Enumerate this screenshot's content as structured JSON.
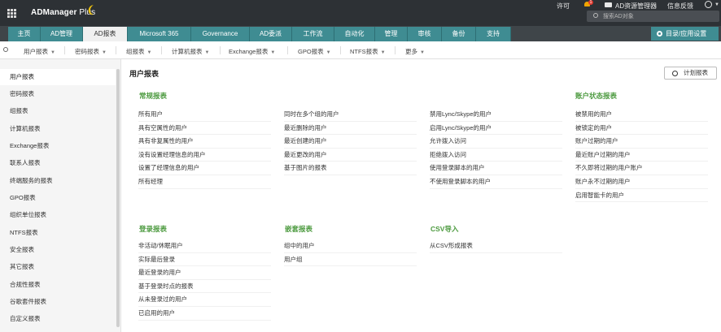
{
  "header": {
    "app_name": "ADManager",
    "app_suffix": " Plus",
    "license_label": "许可",
    "notification_count": "1",
    "ad_manager_label": "AD资源管理器",
    "feedback_label": "信息反馈",
    "search_placeholder": "搜索AD对象"
  },
  "main_tabs": [
    "主页",
    "AD管理",
    "AD报表",
    "Microsoft 365",
    "Governance",
    "AD委派",
    "工作流",
    "自动化",
    "管理",
    "审核",
    "备份",
    "支持"
  ],
  "settings_label": "目录/应用设置",
  "sub_nav": [
    "用户报表",
    "密码报表",
    "组报表",
    "计算机报表",
    "Exchange报表",
    "GPO报表",
    "NTFS报表",
    "更多"
  ],
  "sidebar": [
    "用户报表",
    "密码报表",
    "组报表",
    "计算机报表",
    "Exchange报表",
    "联系人报表",
    "终端服务的报表",
    "GPO报表",
    "组织单位报表",
    "NTFS报表",
    "安全报表",
    "其它报表",
    "合规性报表",
    "谷歌套件报表",
    "自定义报表"
  ],
  "page_title": "用户报表",
  "schedule_label": "计划报表",
  "sections": {
    "general": {
      "title": "常规报表",
      "col1": [
        "所有用户",
        "具有空属性的用户",
        "具有非复属性的用户",
        "没有设置经理信息的用户",
        "设置了经理信息的用户",
        "所有经理"
      ],
      "col2": [
        "同时在多个组的用户",
        "最近删除的用户",
        "最近创建的用户",
        "最近更改的用户",
        "基于图片的报表"
      ],
      "col3": [
        "禁用Lync/Skype的用户",
        "启用Lync/Skype的用户",
        "允许拨入访问",
        "拒绝拨入访问",
        "使用登录脚本的用户",
        "不使用登录脚本的用户"
      ]
    },
    "account_status": {
      "title": "账户状态报表",
      "items": [
        "被禁用的用户",
        "被锁定的用户",
        "账户过期的用户",
        "最近账户过期的用户",
        "不久即将过期的用户账户",
        "账户永不过期的用户",
        "启用智能卡的用户"
      ]
    },
    "logon": {
      "title": "登录报表",
      "items": [
        "非活动/休眠用户",
        "实际最后登录",
        "最近登录的用户",
        "基于登录时点的报表",
        "从未登录过的用户",
        "已启用的用户"
      ]
    },
    "nested": {
      "title": "嵌套报表",
      "items": [
        "组中的用户",
        "用户组"
      ]
    },
    "csv": {
      "title": "CSV导入",
      "items": [
        "从CSV形成报表"
      ]
    }
  }
}
